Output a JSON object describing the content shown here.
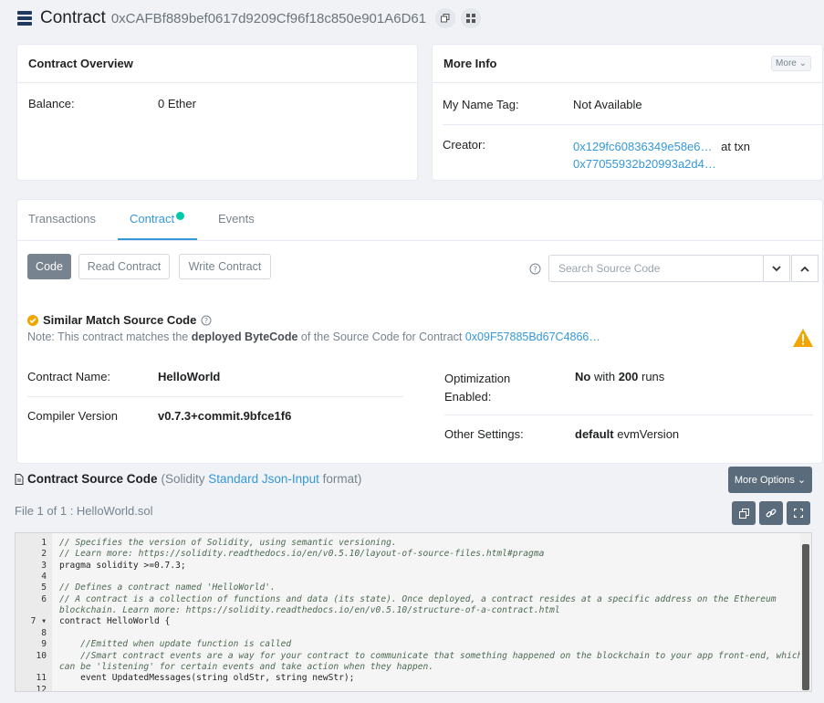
{
  "header": {
    "title": "Contract",
    "address": "0xCAFBf889bef0617d9209Cf96f18c850e901A6D61"
  },
  "overview": {
    "title": "Contract Overview",
    "balance_label": "Balance:",
    "balance_value": "0 Ether"
  },
  "more_info": {
    "title": "More Info",
    "more_button": "More ⌄",
    "name_tag_label": "My Name Tag:",
    "name_tag_value": "Not Available",
    "creator_label": "Creator:",
    "creator_address": "0x129fc60836349e58e6…",
    "at_txn": "at txn",
    "creator_txn": "0x77055932b20993a2d4…"
  },
  "tabs": {
    "transactions": "Transactions",
    "contract": "Contract",
    "events": "Events"
  },
  "code_toolbar": {
    "code": "Code",
    "read": "Read Contract",
    "write": "Write Contract",
    "search_placeholder": "Search Source Code"
  },
  "match": {
    "title": "Similar Match Source Code",
    "note_prefix": "Note: This contract matches the ",
    "note_bold": "deployed ByteCode",
    "note_mid": " of the Source Code for Contract ",
    "note_link": "0x09F57885Bd67C4866…"
  },
  "details": {
    "name_label": "Contract Name:",
    "name_value": "HelloWorld",
    "compiler_label": "Compiler Version",
    "compiler_value": "v0.7.3+commit.9bfce1f6",
    "opt_label_1": "Optimization",
    "opt_label_2": "Enabled:",
    "opt_no": "No",
    "opt_with": " with ",
    "opt_runs_num": "200",
    "opt_runs": " runs",
    "other_label": "Other Settings:",
    "other_bold": "default",
    "other_rest": " evmVersion"
  },
  "source": {
    "title": "Contract Source Code",
    "sub_prefix": "(Solidity ",
    "sub_link": "Standard Json-Input",
    "sub_suffix": " format)",
    "more_options": "More Options ⌄",
    "file_label": "File 1 of 1 : HelloWorld.sol"
  },
  "code_lines": [
    {
      "n": "1",
      "t": "// Specifies the version of Solidity, using semantic versioning.",
      "c": true
    },
    {
      "n": "2",
      "t": "// Learn more: https://solidity.readthedocs.io/en/v0.5.10/layout-of-source-files.html#pragma",
      "c": true
    },
    {
      "n": "3",
      "t": "pragma solidity >=0.7.3;",
      "c": false
    },
    {
      "n": "4",
      "t": "",
      "c": false
    },
    {
      "n": "5",
      "t": "// Defines a contract named 'HelloWorld'.",
      "c": true
    },
    {
      "n": "6",
      "t": "// A contract is a collection of functions and data (its state). Once deployed, a contract resides at a specific address on the Ethereum",
      "c": true
    },
    {
      "n": "",
      "t": "blockchain. Learn more: https://solidity.readthedocs.io/en/v0.5.10/structure-of-a-contract.html",
      "c": true
    },
    {
      "n": "7 ▾",
      "t": "contract HelloWorld {",
      "c": false
    },
    {
      "n": "8",
      "t": "",
      "c": false
    },
    {
      "n": "9",
      "t": "    //Emitted when update function is called",
      "c": true
    },
    {
      "n": "10",
      "t": "    //Smart contract events are a way for your contract to communicate that something happened on the blockchain to your app front-end, which",
      "c": true
    },
    {
      "n": "",
      "t": "can be 'listening' for certain events and take action when they happen.",
      "c": true
    },
    {
      "n": "11",
      "t": "    event UpdatedMessages(string oldStr, string newStr);",
      "c": false
    },
    {
      "n": "12",
      "t": "",
      "c": false
    }
  ]
}
